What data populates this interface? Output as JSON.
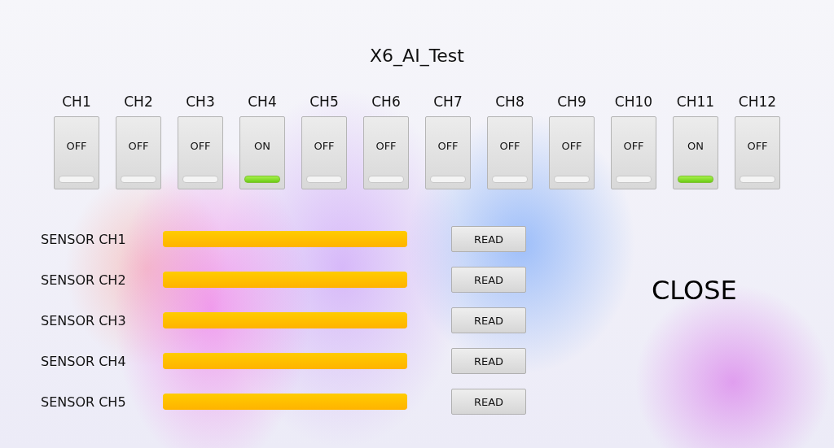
{
  "title": "X6_AI_Test",
  "channels": [
    {
      "label": "CH1",
      "state": "OFF",
      "on": false
    },
    {
      "label": "CH2",
      "state": "OFF",
      "on": false
    },
    {
      "label": "CH3",
      "state": "OFF",
      "on": false
    },
    {
      "label": "CH4",
      "state": "ON",
      "on": true
    },
    {
      "label": "CH5",
      "state": "OFF",
      "on": false
    },
    {
      "label": "CH6",
      "state": "OFF",
      "on": false
    },
    {
      "label": "CH7",
      "state": "OFF",
      "on": false
    },
    {
      "label": "CH8",
      "state": "OFF",
      "on": false
    },
    {
      "label": "CH9",
      "state": "OFF",
      "on": false
    },
    {
      "label": "CH10",
      "state": "OFF",
      "on": false
    },
    {
      "label": "CH11",
      "state": "ON",
      "on": true
    },
    {
      "label": "CH12",
      "state": "OFF",
      "on": false
    }
  ],
  "sensors": [
    {
      "label": "SENSOR CH1",
      "level": 1,
      "button": "READ"
    },
    {
      "label": "SENSOR CH2",
      "level": 1,
      "button": "READ"
    },
    {
      "label": "SENSOR CH3",
      "level": 1,
      "button": "READ"
    },
    {
      "label": "SENSOR CH4",
      "level": 1,
      "button": "READ"
    },
    {
      "label": "SENSOR CH5",
      "level": 1,
      "button": "READ"
    }
  ],
  "close_button": "CLOSE"
}
